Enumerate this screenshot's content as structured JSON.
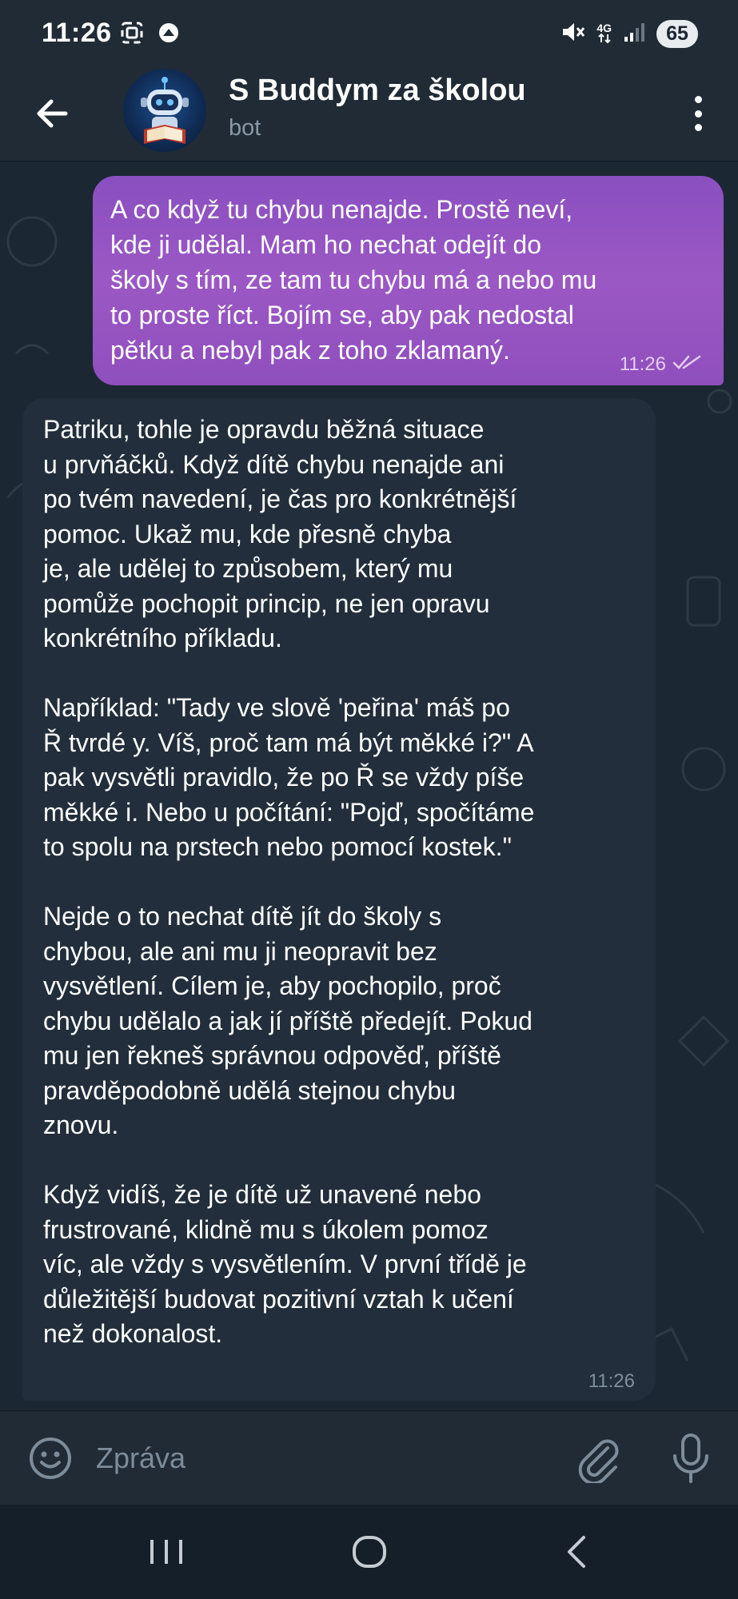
{
  "status_bar": {
    "time": "11:26",
    "network": "4G",
    "battery": "65",
    "icons": [
      "screenshot-icon",
      "app-notification-icon",
      "mute-icon",
      "network-4g-icon",
      "signal-icon",
      "battery-icon"
    ]
  },
  "header": {
    "title": "S Buddym za školou",
    "subtitle": "bot",
    "icons": [
      "back-arrow-icon",
      "bot-avatar",
      "more-vertical-icon"
    ]
  },
  "messages": [
    {
      "direction": "outgoing",
      "text": "A co když tu chybu nenajde. Prostě neví,\nkde ji udělal. Mam ho nechat odejít do\nškoly s tím, ze tam tu chybu má a nebo mu\nto proste říct. Bojím se, aby pak nedostal\npětku a nebyl pak z toho zklamaný.",
      "time": "11:26",
      "status": "read"
    },
    {
      "direction": "incoming",
      "text": "Patriku, tohle je opravdu běžná situace\nu prvňáčků. Když dítě chybu nenajde ani\npo tvém navedení, je čas pro konkrétnější\npomoc. Ukaž mu, kde přesně chyba\nje, ale udělej to způsobem, který mu\npomůže pochopit princip, ne jen opravu\nkonkrétního příkladu.\n\nNapříklad: \"Tady ve slově 'peřina' máš po\nŘ tvrdé y. Víš, proč tam má být měkké i?\" A\npak vysvětli pravidlo, že po Ř se vždy píše\nměkké i. Nebo u počítání: \"Pojď, spočítáme\nto spolu na prstech nebo pomocí kostek.\"\n\nNejde o to nechat dítě jít do školy s\nchybou, ale ani mu ji neopravit bez\nvysvětlení. Cílem je, aby pochopilo, proč\nchybu udělalo a jak jí příště předejít. Pokud\nmu jen řekneš správnou odpověď, příště\npravděpodobně udělá stejnou chybu\nznovu.\n\nKdyž vidíš, že je dítě už unavené nebo\nfrustrované, klidně mu s úkolem pomoz\nvíc, ale vždy s vysvětlením. V první třídě je\ndůležitější budovat pozitivní vztah k učení\nnež dokonalost.",
      "time": "11:26"
    }
  ],
  "composer": {
    "placeholder": "Zpráva",
    "icons": [
      "emoji-icon",
      "attach-icon",
      "microphone-icon"
    ]
  },
  "nav_bar": {
    "icons": [
      "recent-apps-icon",
      "home-icon",
      "back-icon"
    ]
  },
  "colors": {
    "chat_background": "#1b2833",
    "header_background": "#202b36",
    "outgoing_bubble": "#9155c2",
    "incoming_bubble": "#222e3b",
    "nav_background": "#151f29"
  }
}
